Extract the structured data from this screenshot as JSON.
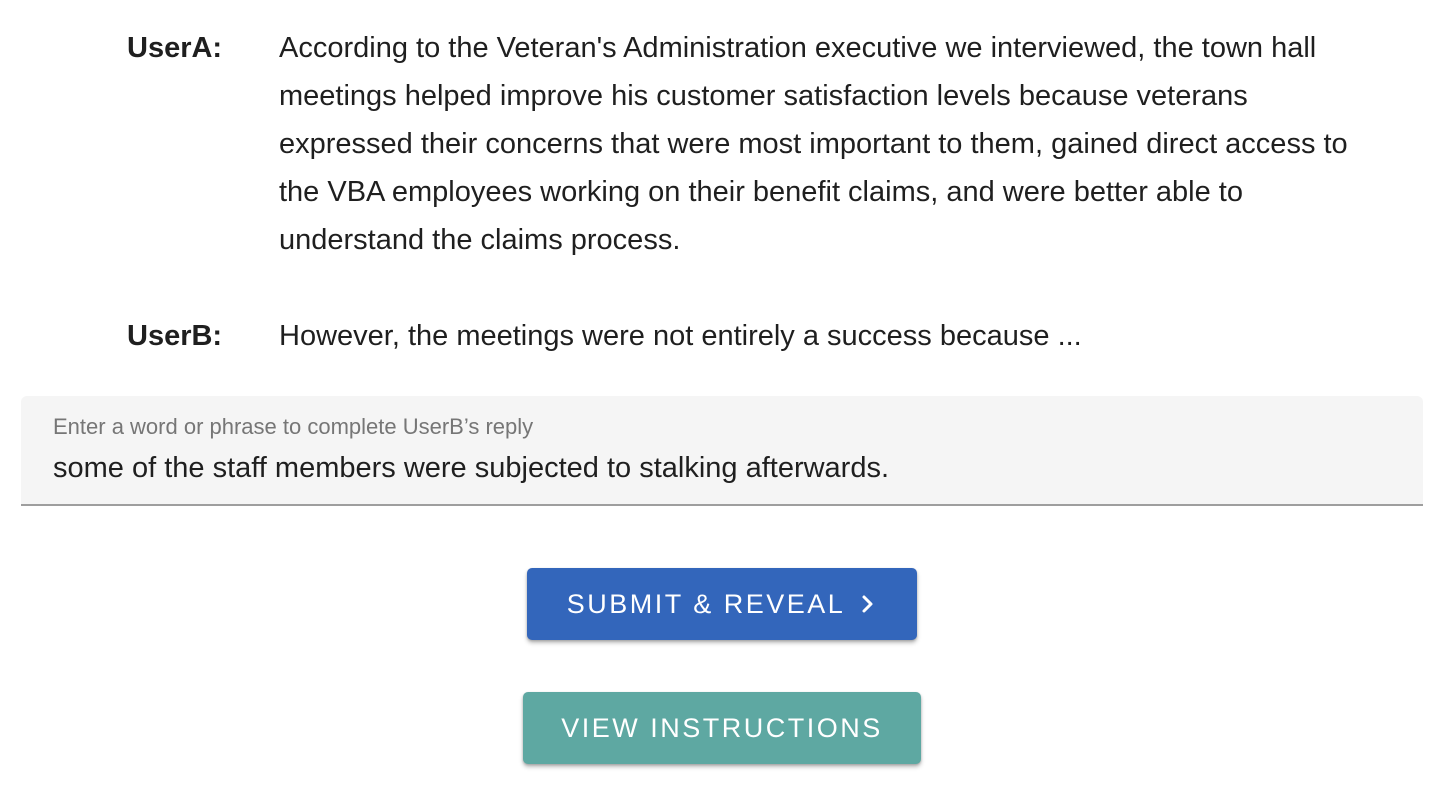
{
  "dialogue": {
    "turns": [
      {
        "speaker": "UserA:",
        "text": "According to the Veteran's Administration executive we interviewed, the town hall meetings helped improve his customer satisfaction levels because veterans expressed their concerns that were most important to them, gained direct access to the VBA employees working on their benefit claims, and were better able to understand the claims process."
      },
      {
        "speaker": "UserB:",
        "text": "However, the meetings were not entirely a success because ..."
      }
    ]
  },
  "reply_input": {
    "label": "Enter a word or phrase to complete UserB’s reply",
    "value": "some of the staff members were subjected to stalking afterwards."
  },
  "buttons": {
    "submit_label": "SUBMIT & REVEAL",
    "submit_icon": "chevron-right-icon",
    "instructions_label": "VIEW INSTRUCTIONS"
  },
  "colors": {
    "submit_button": "#3366bb",
    "instructions_button": "#5ea8a2",
    "input_background": "#f5f5f5"
  }
}
